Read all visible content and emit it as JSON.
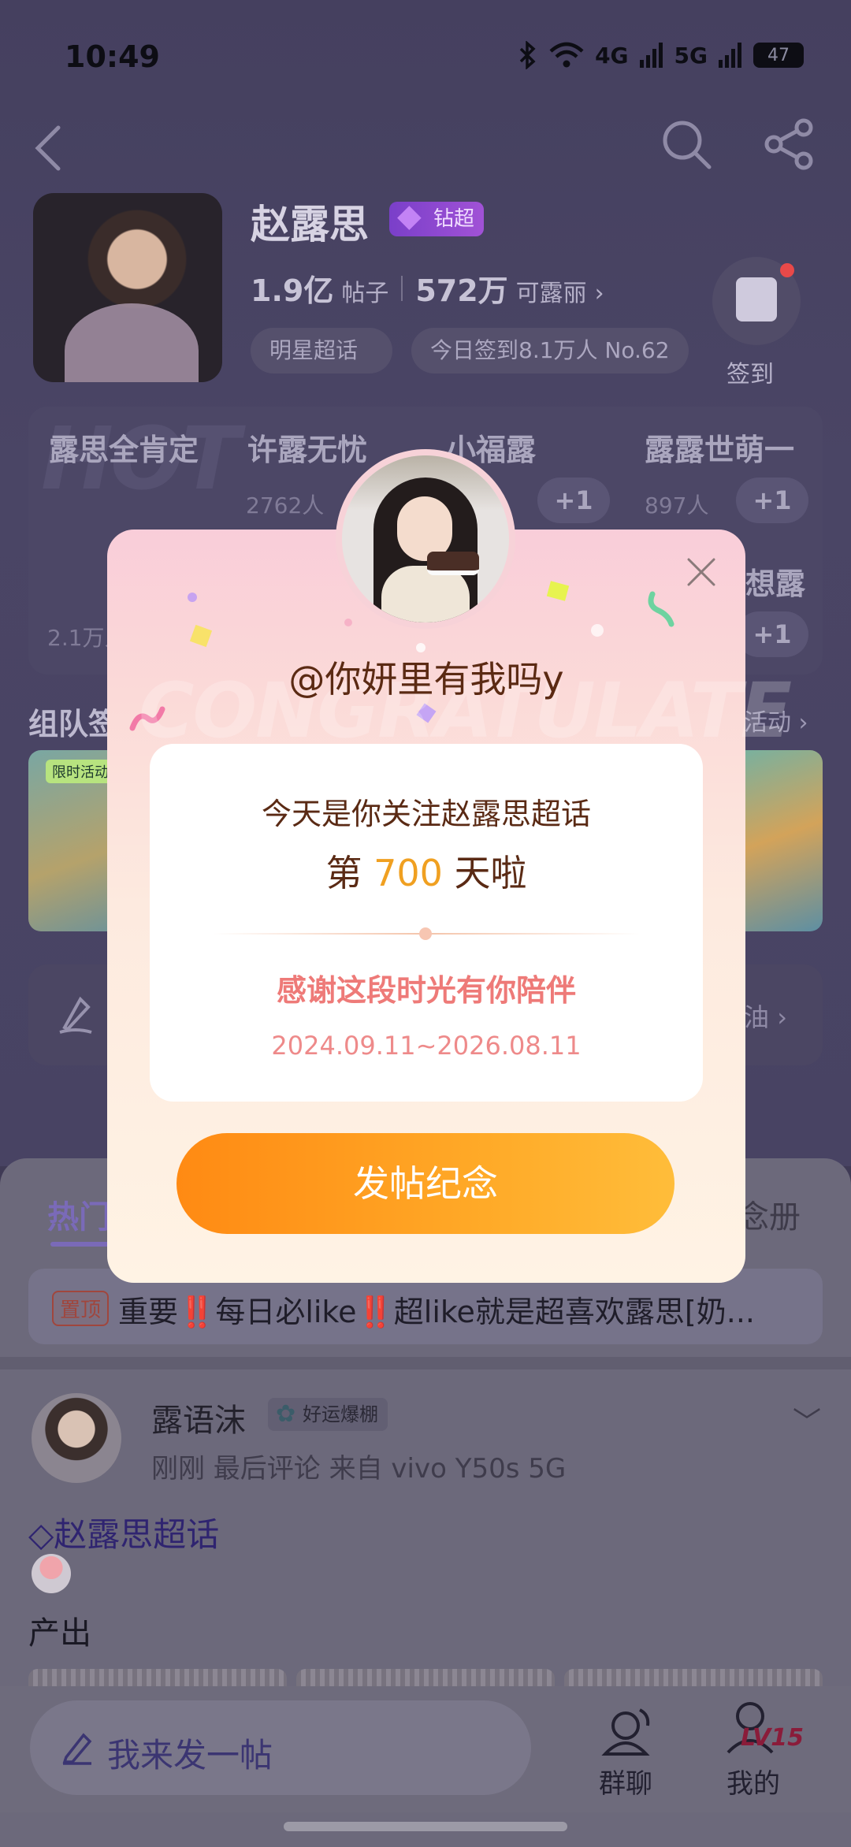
{
  "status_bar": {
    "time": "10:49",
    "net1": "4G",
    "net2": "5G",
    "battery": "47"
  },
  "profile": {
    "name": "赵露思",
    "badge": "钻超",
    "posts_count": "1.9亿",
    "posts_label": "帖子",
    "fans_count": "572万",
    "fans_label": "可露丽",
    "fans_arrow": "›",
    "tags": [
      "明星超话",
      "今日签到8.1万人 No.62"
    ],
    "checkin_label": "签到"
  },
  "hot_grid": {
    "watermark": "HOT",
    "cells": [
      {
        "title": "露思全肯定",
        "sub": "2.1万人"
      },
      {
        "title": "许露无忧",
        "sub": "2762人",
        "plus": "+1"
      },
      {
        "title": "小福露",
        "sub": ""
      },
      {
        "title": "露露世萌一",
        "sub": "897人",
        "plus": "+1"
      },
      {
        "title": "想露",
        "sub": "",
        "plus": "+1"
      }
    ]
  },
  "section": {
    "title": "组队签",
    "more": "活动 ›",
    "banner_tag": "限时活动"
  },
  "quick_bar": {
    "right_text": "油"
  },
  "tabs": {
    "hot": "热门",
    "right": "念册"
  },
  "pinned": {
    "tag": "置顶",
    "text": "重要‼️每日必like‼️超like就是超喜欢露思[奶..."
  },
  "post": {
    "author": "露语沫",
    "badge": "好运爆棚",
    "meta": "刚刚 最后评论   来自 vivo Y50s 5G",
    "topic": "◇赵露思超话",
    "text": "产出"
  },
  "bottom_bar": {
    "compose_placeholder": "我来发一帖",
    "group_chat": "群聊",
    "mine": "我的",
    "level": "LV15"
  },
  "modal": {
    "watermark": "CONGRATULATE",
    "username": "@你妍里有我吗y",
    "line1": "今天是你关注赵露思超话",
    "line2_prefix": "第 ",
    "days": "700",
    "line2_suffix": " 天啦",
    "thanks": "感谢这段时光有你陪伴",
    "dates": "2024.09.11~2026.08.11",
    "cta": "发帖纪念"
  },
  "colors": {
    "accent_orange": "#ff9a1f",
    "days_highlight": "#f0a021",
    "thanks_pink": "#ee7a78",
    "text_brown": "#5a2a14"
  }
}
